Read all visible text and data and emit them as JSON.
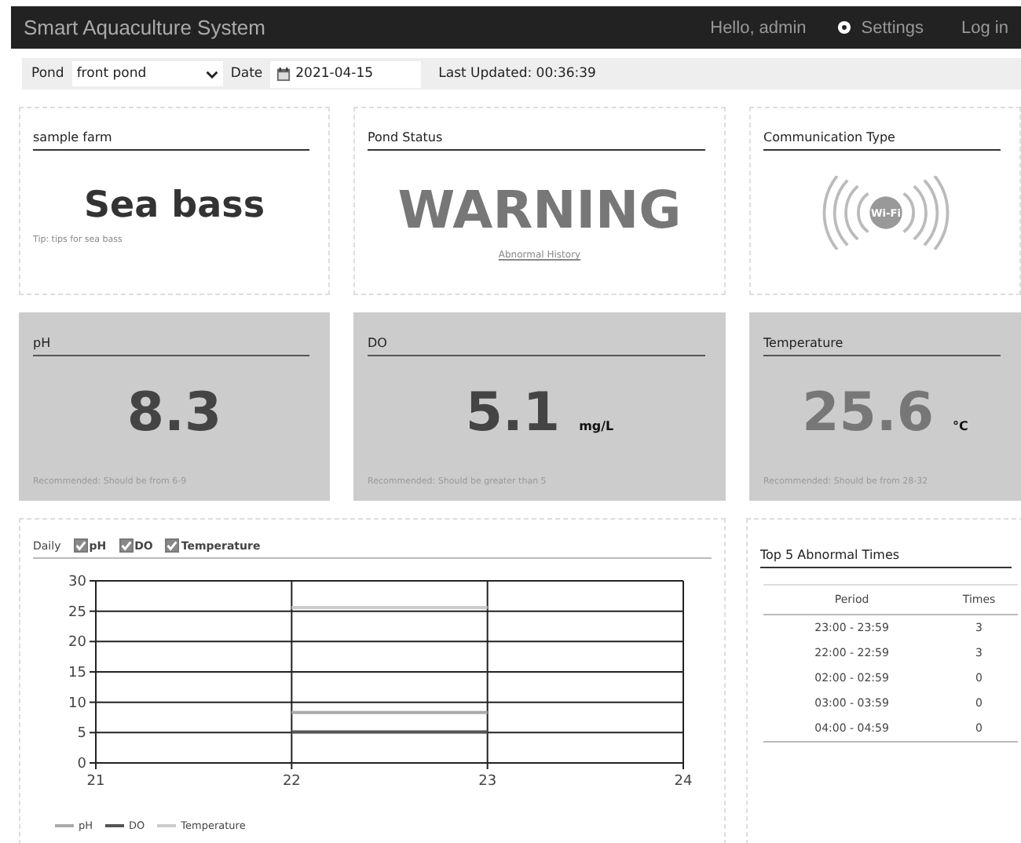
{
  "navbar": {
    "brand": "Smart Aquaculture System",
    "greeting": "Hello, admin",
    "settings": "Settings",
    "login": "Log in"
  },
  "toolbar": {
    "pond_label": "Pond",
    "pond_value": "front pond",
    "date_label": "Date",
    "date_value": "2021-04-15",
    "updated_label": "Last Updated:",
    "updated_value": "00:36:39"
  },
  "info_cards": [
    {
      "kind": "species",
      "title": "sample farm",
      "value": "Sea bass",
      "note": "Tip: tips for sea bass"
    },
    {
      "kind": "status",
      "title": "Pond Status",
      "value": "WARNING",
      "link": "Abnormal History"
    },
    {
      "kind": "wifi",
      "title": "Communication Type",
      "icon_text": "Wi-Fi"
    }
  ],
  "metrics": [
    {
      "title": "pH",
      "value": "8.3",
      "recommended": "Recommended: Should be from 6-9",
      "abnormal": false
    },
    {
      "title": "DO",
      "value": "5.1",
      "unit": "mg/L",
      "recommended": "Recommended: Should be greater than 5",
      "abnormal": false
    },
    {
      "title": "Temperature",
      "value": "25.6",
      "unit": "°C",
      "recommended": "Recommended: Should be from 28-32",
      "abnormal": true
    }
  ],
  "chart_panel": {
    "period": "Daily",
    "toggles": [
      {
        "label": "pH",
        "checked": true
      },
      {
        "label": "DO",
        "checked": true
      },
      {
        "label": "Temperature",
        "checked": true
      }
    ],
    "chart_data": {
      "type": "line",
      "x": [
        22,
        23
      ],
      "xlim": [
        21,
        24
      ],
      "xticks": [
        21,
        22,
        23,
        24
      ],
      "ylim": [
        0,
        30
      ],
      "yticks": [
        0,
        5,
        10,
        15,
        20,
        25,
        30
      ],
      "grid": true,
      "legend": "bottom-left",
      "series": [
        {
          "name": "pH",
          "color": "#aaaaaa",
          "values": [
            8.3,
            8.3
          ]
        },
        {
          "name": "DO",
          "color": "#555555",
          "values": [
            5.1,
            5.1
          ]
        },
        {
          "name": "Temperature",
          "color": "#cccccc",
          "values": [
            25.6,
            25.6
          ]
        }
      ]
    }
  },
  "abnormal_table": {
    "title": "Top 5 Abnormal Times",
    "columns": [
      "Period",
      "Times"
    ],
    "rows": [
      [
        "23:00 - 23:59",
        "3"
      ],
      [
        "22:00 - 22:59",
        "3"
      ],
      [
        "02:00 - 02:59",
        "0"
      ],
      [
        "03:00 - 03:59",
        "0"
      ],
      [
        "04:00 - 04:59",
        "0"
      ]
    ]
  }
}
